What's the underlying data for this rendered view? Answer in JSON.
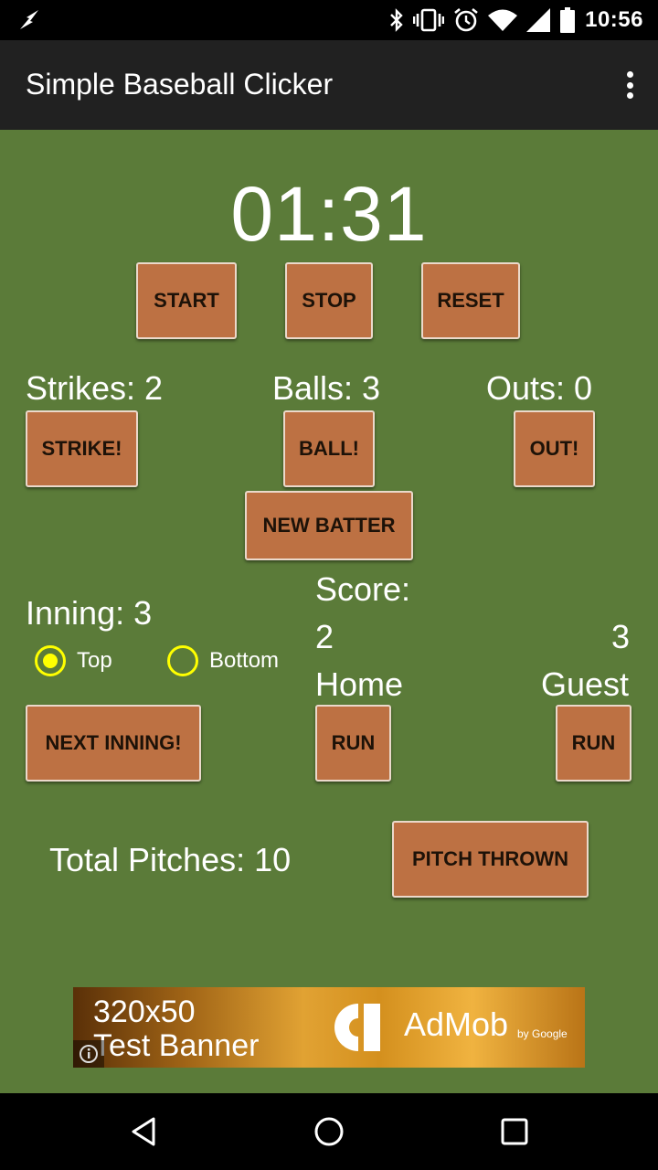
{
  "status_bar": {
    "time": "10:56",
    "icons": [
      "bolt-icon",
      "bluetooth-icon",
      "vibrate-icon",
      "alarm-icon",
      "wifi-icon",
      "cell-signal-icon",
      "battery-icon"
    ]
  },
  "app_bar": {
    "title": "Simple Baseball Clicker",
    "menu_icon": "overflow-menu-icon"
  },
  "timer": {
    "display": "01:31",
    "start_label": "START",
    "stop_label": "STOP",
    "reset_label": "RESET"
  },
  "count": {
    "strikes_label": "Strikes: 2",
    "balls_label": "Balls: 3",
    "outs_label": "Outs: 0",
    "strike_button": "STRIKE!",
    "ball_button": "BALL!",
    "out_button": "OUT!",
    "new_batter_button": "NEW BATTER"
  },
  "inning": {
    "label": "Inning: 3",
    "top_label": "Top",
    "bottom_label": "Bottom",
    "selected": "Top",
    "next_button": "NEXT INNING!"
  },
  "score": {
    "label": "Score:",
    "home_score": "2",
    "guest_score": "3",
    "home_label": "Home",
    "guest_label": "Guest",
    "home_run_button": "RUN",
    "guest_run_button": "RUN"
  },
  "pitches": {
    "total_label": "Total Pitches: 10",
    "pitch_button": "PITCH THROWN"
  },
  "ad": {
    "line1": "320x50",
    "line2": "Test Banner",
    "brand": "AdMob",
    "by": "by Google"
  },
  "colors": {
    "content_bg": "#5b7b39",
    "button_bg": "#bd7143",
    "radio_accent": "#ffff00",
    "app_bar_bg": "#212121"
  }
}
